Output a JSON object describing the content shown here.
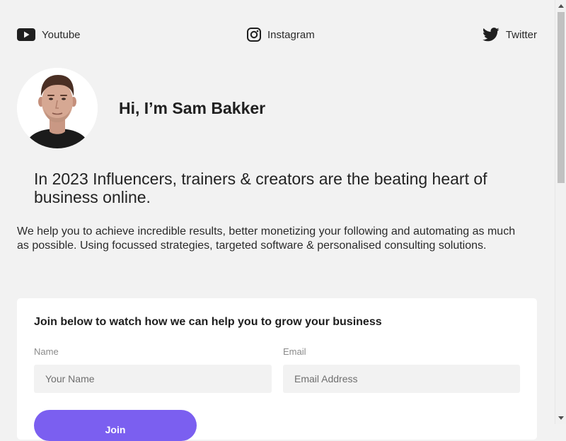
{
  "social": {
    "youtube": {
      "label": "Youtube",
      "icon": "youtube-icon"
    },
    "instagram": {
      "label": "Instagram",
      "icon": "instagram-icon"
    },
    "twitter": {
      "label": "Twitter",
      "icon": "twitter-icon"
    }
  },
  "profile": {
    "greeting": "Hi, I’m Sam Bakker"
  },
  "headline": "In 2023 Influencers, trainers & creators are the beating heart of business online.",
  "intro": "We help you to achieve incredible results, better monetizing your following and automating as much as possible. Using focussed strategies, targeted software & personalised consulting solutions.",
  "signup": {
    "title": "Join below to watch how we can help you to grow your business",
    "name_label": "Name",
    "name_placeholder": "Your Name",
    "email_label": "Email",
    "email_placeholder": "Email Address",
    "button_label": "Join"
  },
  "colors": {
    "background": "#f2f2f2",
    "card": "#ffffff",
    "accent": "#7b5ff0",
    "field": "#f2f2f2"
  }
}
